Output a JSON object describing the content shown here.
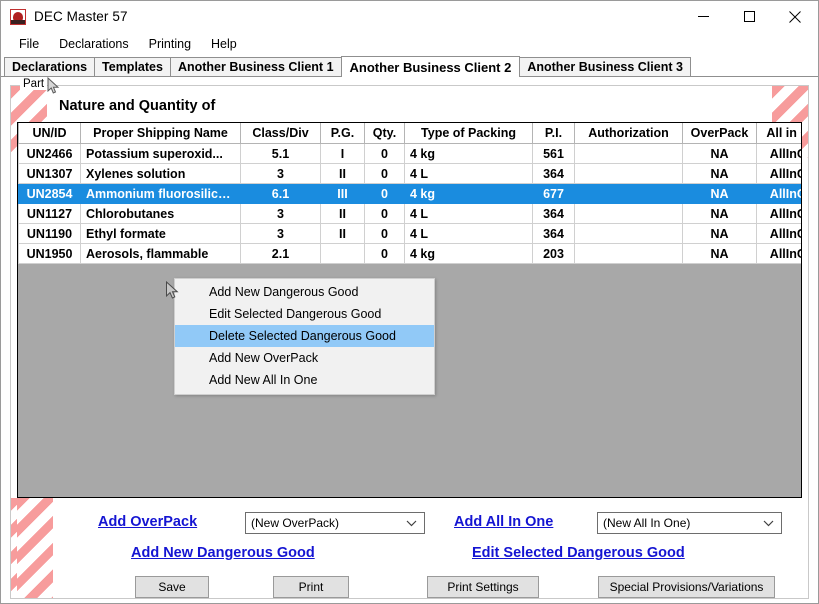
{
  "window": {
    "title": "DEC Master 57",
    "icon": "app-icon",
    "minimize_label": "Minimize",
    "maximize_label": "Maximize",
    "close_label": "Close"
  },
  "menubar": {
    "items": [
      {
        "label": "File"
      },
      {
        "label": "Declarations"
      },
      {
        "label": "Printing"
      },
      {
        "label": "Help"
      }
    ]
  },
  "tabs": [
    {
      "label": "Declarations",
      "active": false
    },
    {
      "label": "Templates",
      "active": false
    },
    {
      "label": "Another Business Client 1",
      "active": false
    },
    {
      "label": "Another Business Client 2",
      "active": true
    },
    {
      "label": "Another Business Client 3",
      "active": false
    }
  ],
  "group": {
    "label": "Part",
    "heading": "Nature and Quantity of"
  },
  "grid": {
    "columns": [
      "UN/ID",
      "Proper Shipping Name",
      "Class/Div",
      "P.G.",
      "Qty.",
      "Type of Packing",
      "P.I.",
      "Authorization",
      "OverPack",
      "All in One"
    ],
    "rows": [
      {
        "un_id": "UN2466",
        "proper_shipping_name": "Potassium superoxid...",
        "class_div": "5.1",
        "pg": "I",
        "qty": "0",
        "type_of_packing": "4 kg",
        "pi": "561",
        "authorization": "",
        "overpack": "NA",
        "all_in_one": "AllInOne",
        "selected": false
      },
      {
        "un_id": "UN1307",
        "proper_shipping_name": "Xylenes solution",
        "class_div": "3",
        "pg": "II",
        "qty": "0",
        "type_of_packing": "4 L",
        "pi": "364",
        "authorization": "",
        "overpack": "NA",
        "all_in_one": "AllInOne",
        "selected": false
      },
      {
        "un_id": "UN2854",
        "proper_shipping_name": "Ammonium fluorosilicate",
        "class_div": "6.1",
        "pg": "III",
        "qty": "0",
        "type_of_packing": "4 kg",
        "pi": "677",
        "authorization": "",
        "overpack": "NA",
        "all_in_one": "AllInOne",
        "selected": true
      },
      {
        "un_id": "UN1127",
        "proper_shipping_name": "Chlorobutanes",
        "class_div": "3",
        "pg": "II",
        "qty": "0",
        "type_of_packing": "4 L",
        "pi": "364",
        "authorization": "",
        "overpack": "NA",
        "all_in_one": "AllInOne",
        "selected": false
      },
      {
        "un_id": "UN1190",
        "proper_shipping_name": "Ethyl formate",
        "class_div": "3",
        "pg": "II",
        "qty": "0",
        "type_of_packing": "4 L",
        "pi": "364",
        "authorization": "",
        "overpack": "NA",
        "all_in_one": "AllInOne",
        "selected": false
      },
      {
        "un_id": "UN1950",
        "proper_shipping_name": "Aerosols, flammable",
        "class_div": "2.1",
        "pg": "",
        "qty": "0",
        "type_of_packing": "4 kg",
        "pi": "203",
        "authorization": "",
        "overpack": "NA",
        "all_in_one": "AllInOne",
        "selected": false
      }
    ]
  },
  "context_menu": {
    "items": [
      {
        "label": "Add New Dangerous Good",
        "highlighted": false
      },
      {
        "label": "Edit Selected Dangerous Good",
        "highlighted": false
      },
      {
        "label": "Delete Selected Dangerous Good",
        "highlighted": true
      },
      {
        "label": "Add New OverPack",
        "highlighted": false
      },
      {
        "label": "Add New All In One",
        "highlighted": false
      }
    ]
  },
  "bottom": {
    "add_overpack_link": "Add OverPack",
    "overpack_combo_value": "(New OverPack)",
    "add_all_in_one_link": "Add All In One",
    "all_in_one_combo_value": "(New All In One)",
    "add_new_dangerous_good_link": "Add New Dangerous Good",
    "edit_selected_dangerous_good_link": "Edit Selected Dangerous Good",
    "save_button": "Save",
    "print_button": "Print",
    "print_settings_button": "Print Settings",
    "special_provisions_button": "Special Provisions/Variations"
  },
  "colors": {
    "selection_blue": "#1a8cdf",
    "menu_highlight": "#91c9f7",
    "link_blue": "#1414d2",
    "stripe_pink": "#f79c9c",
    "grid_background": "#a8a8a8"
  }
}
